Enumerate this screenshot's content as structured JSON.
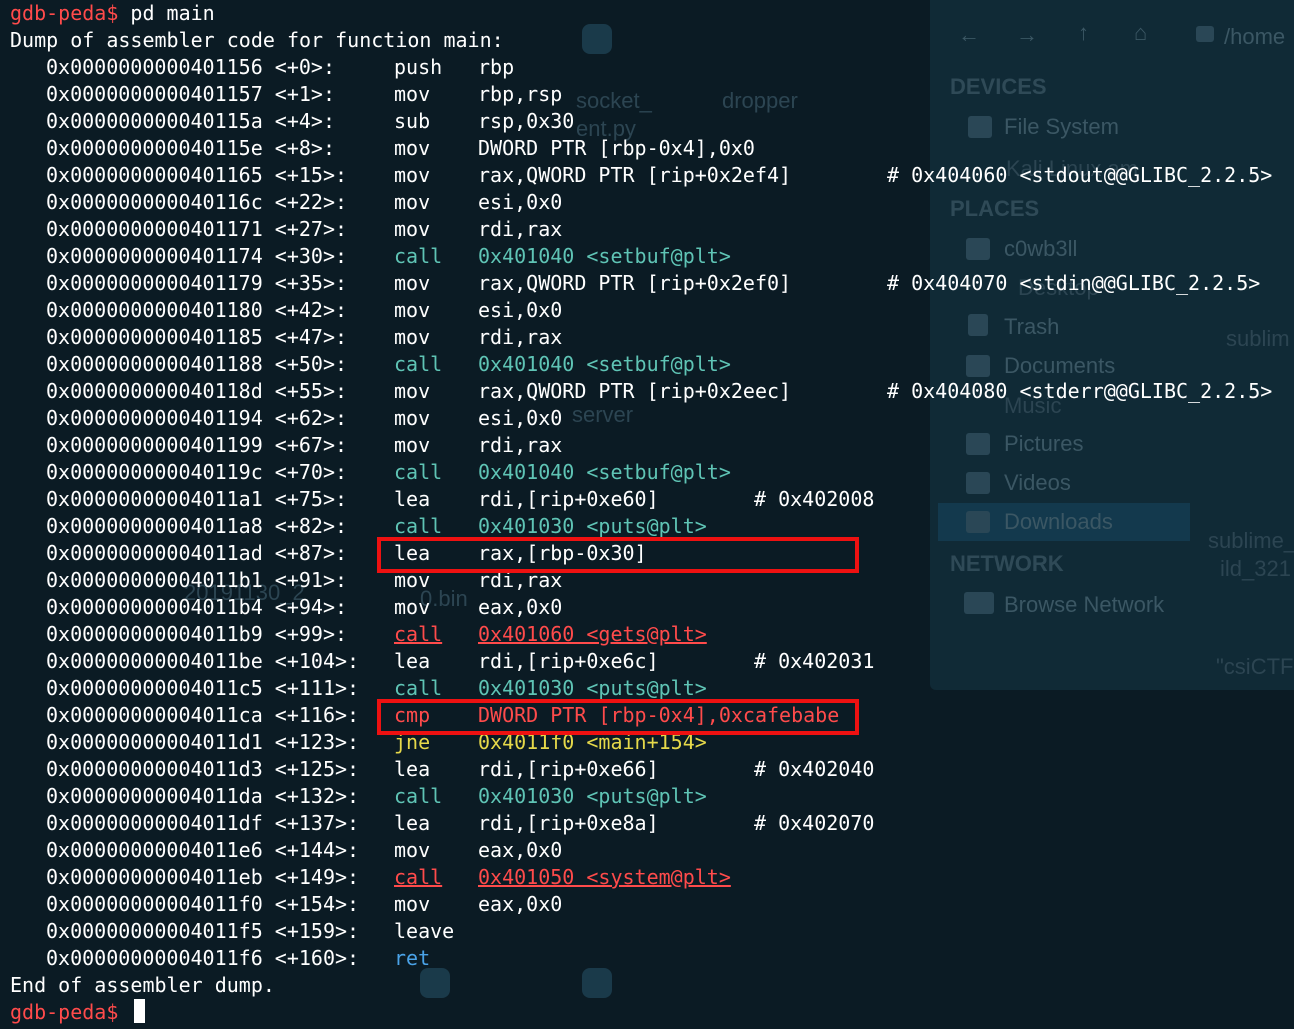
{
  "terminal": {
    "prompt": "gdb-peda$",
    "command": "pd main",
    "dump_header": "Dump of assembler code for function main:",
    "dump_footer": "End of assembler dump.",
    "instructions": [
      {
        "address": "0x0000000000401156 <+0>:",
        "op": "push",
        "args": "rbp",
        "comment": "",
        "kind": "plain"
      },
      {
        "address": "0x0000000000401157 <+1>:",
        "op": "mov",
        "args": "rbp,rsp",
        "comment": "",
        "kind": "plain"
      },
      {
        "address": "0x000000000040115a <+4>:",
        "op": "sub",
        "args": "rsp,0x30",
        "comment": "",
        "kind": "plain"
      },
      {
        "address": "0x000000000040115e <+8>:",
        "op": "mov",
        "args": "DWORD PTR [rbp-0x4],0x0",
        "comment": "",
        "kind": "plain"
      },
      {
        "address": "0x0000000000401165 <+15>:",
        "op": "mov",
        "args": "rax,QWORD PTR [rip+0x2ef4]",
        "comment": "# 0x404060 <stdout@@GLIBC_2.2.5>",
        "kind": "plain"
      },
      {
        "address": "0x000000000040116c <+22>:",
        "op": "mov",
        "args": "esi,0x0",
        "comment": "",
        "kind": "plain"
      },
      {
        "address": "0x0000000000401171 <+27>:",
        "op": "mov",
        "args": "rdi,rax",
        "comment": "",
        "kind": "plain"
      },
      {
        "address": "0x0000000000401174 <+30>:",
        "op": "call",
        "args": "0x401040 <setbuf@plt>",
        "comment": "",
        "kind": "call"
      },
      {
        "address": "0x0000000000401179 <+35>:",
        "op": "mov",
        "args": "rax,QWORD PTR [rip+0x2ef0]",
        "comment": "# 0x404070 <stdin@@GLIBC_2.2.5>",
        "kind": "plain"
      },
      {
        "address": "0x0000000000401180 <+42>:",
        "op": "mov",
        "args": "esi,0x0",
        "comment": "",
        "kind": "plain"
      },
      {
        "address": "0x0000000000401185 <+47>:",
        "op": "mov",
        "args": "rdi,rax",
        "comment": "",
        "kind": "plain"
      },
      {
        "address": "0x0000000000401188 <+50>:",
        "op": "call",
        "args": "0x401040 <setbuf@plt>",
        "comment": "",
        "kind": "call"
      },
      {
        "address": "0x000000000040118d <+55>:",
        "op": "mov",
        "args": "rax,QWORD PTR [rip+0x2eec]",
        "comment": "# 0x404080 <stderr@@GLIBC_2.2.5>",
        "kind": "plain"
      },
      {
        "address": "0x0000000000401194 <+62>:",
        "op": "mov",
        "args": "esi,0x0",
        "comment": "",
        "kind": "plain"
      },
      {
        "address": "0x0000000000401199 <+67>:",
        "op": "mov",
        "args": "rdi,rax",
        "comment": "",
        "kind": "plain"
      },
      {
        "address": "0x000000000040119c <+70>:",
        "op": "call",
        "args": "0x401040 <setbuf@plt>",
        "comment": "",
        "kind": "call"
      },
      {
        "address": "0x00000000004011a1 <+75>:",
        "op": "lea",
        "args": "rdi,[rip+0xe60]",
        "comment": "# 0x402008",
        "kind": "plain"
      },
      {
        "address": "0x00000000004011a8 <+82>:",
        "op": "call",
        "args": "0x401030 <puts@plt>",
        "comment": "",
        "kind": "call"
      },
      {
        "address": "0x00000000004011ad <+87>:",
        "op": "lea",
        "args": "rax,[rbp-0x30]",
        "comment": "",
        "kind": "plain"
      },
      {
        "address": "0x00000000004011b1 <+91>:",
        "op": "mov",
        "args": "rdi,rax",
        "comment": "",
        "kind": "plain"
      },
      {
        "address": "0x00000000004011b4 <+94>:",
        "op": "mov",
        "args": "eax,0x0",
        "comment": "",
        "kind": "plain"
      },
      {
        "address": "0x00000000004011b9 <+99>:",
        "op": "call",
        "args": "0x401060 <gets@plt>",
        "comment": "",
        "kind": "danger"
      },
      {
        "address": "0x00000000004011be <+104>:",
        "op": "lea",
        "args": "rdi,[rip+0xe6c]",
        "comment": "# 0x402031",
        "kind": "plain"
      },
      {
        "address": "0x00000000004011c5 <+111>:",
        "op": "call",
        "args": "0x401030 <puts@plt>",
        "comment": "",
        "kind": "call"
      },
      {
        "address": "0x00000000004011ca <+116>:",
        "op": "cmp",
        "args": "DWORD PTR [rbp-0x4],0xcafebabe",
        "comment": "",
        "kind": "cmp"
      },
      {
        "address": "0x00000000004011d1 <+123>:",
        "op": "jne",
        "args": "0x4011f0 <main+154>",
        "comment": "",
        "kind": "jump"
      },
      {
        "address": "0x00000000004011d3 <+125>:",
        "op": "lea",
        "args": "rdi,[rip+0xe66]",
        "comment": "# 0x402040",
        "kind": "plain"
      },
      {
        "address": "0x00000000004011da <+132>:",
        "op": "call",
        "args": "0x401030 <puts@plt>",
        "comment": "",
        "kind": "call"
      },
      {
        "address": "0x00000000004011df <+137>:",
        "op": "lea",
        "args": "rdi,[rip+0xe8a]",
        "comment": "# 0x402070",
        "kind": "plain"
      },
      {
        "address": "0x00000000004011e6 <+144>:",
        "op": "mov",
        "args": "eax,0x0",
        "comment": "",
        "kind": "plain"
      },
      {
        "address": "0x00000000004011eb <+149>:",
        "op": "call",
        "args": "0x401050 <system@plt>",
        "comment": "",
        "kind": "danger"
      },
      {
        "address": "0x00000000004011f0 <+154>:",
        "op": "mov",
        "args": "eax,0x0",
        "comment": "",
        "kind": "plain"
      },
      {
        "address": "0x00000000004011f5 <+159>:",
        "op": "leave",
        "args": "",
        "comment": "",
        "kind": "plain"
      },
      {
        "address": "0x00000000004011f6 <+160>:",
        "op": "ret",
        "args": "",
        "comment": "",
        "kind": "ret"
      }
    ]
  },
  "colors": {
    "prompt": "#ff4b4b",
    "call": "#5fc4b5",
    "jump": "#e6d94a",
    "ret": "#4aa3e8",
    "danger": "#ff4b4b",
    "highlight_box": "#ee1111"
  },
  "file_manager": {
    "path": "/home",
    "sections": [
      {
        "title": "DEVICES",
        "items": [
          {
            "label": "File System",
            "icon": "drive-icon"
          }
        ]
      },
      {
        "title": "PLACES",
        "items": [
          {
            "label": "c0wb3ll",
            "icon": "folder-icon"
          },
          {
            "label": "Trash",
            "icon": "trash-icon"
          },
          {
            "label": "Documents",
            "icon": "folder-icon"
          },
          {
            "label": "Pictures",
            "icon": "folder-icon"
          },
          {
            "label": "Videos",
            "icon": "folder-icon"
          },
          {
            "label": "Downloads",
            "icon": "folder-icon"
          }
        ]
      },
      {
        "title": "NETWORK",
        "items": [
          {
            "label": "Browse Network",
            "icon": "network-icon"
          }
        ]
      }
    ]
  },
  "desktop_items": [
    "dropper",
    "socket_",
    "ent.py",
    "Kali Linux am",
    "Desktop",
    "Music",
    "sublim",
    "sublime_",
    "ild_321",
    "\"csiCTF",
    "server",
    "0.bin",
    "20191130_2"
  ]
}
